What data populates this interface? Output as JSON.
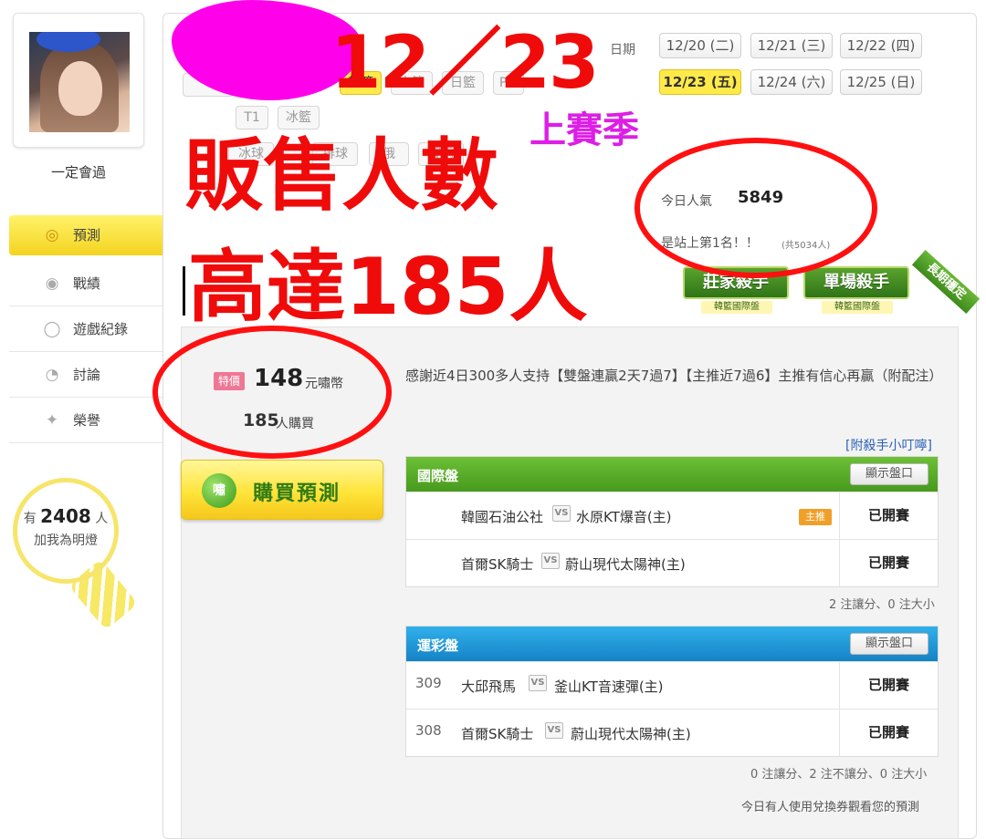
{
  "profile": {
    "username": "一定會過"
  },
  "nav": {
    "items": [
      {
        "label": "預測",
        "icon": "target-icon",
        "glyph": "◎",
        "active": true
      },
      {
        "label": "戰績",
        "icon": "record-icon",
        "glyph": "◉",
        "active": false
      },
      {
        "label": "遊戲紀錄",
        "icon": "history-icon",
        "glyph": "◯",
        "active": false
      },
      {
        "label": "討論",
        "icon": "discussion-icon",
        "glyph": "◔",
        "active": false
      },
      {
        "label": "榮譽",
        "icon": "honor-icon",
        "glyph": "✦",
        "active": false
      }
    ]
  },
  "fans": {
    "prefix": "有",
    "count": "2408",
    "suffix": "人",
    "line2": "加我為明燈"
  },
  "dates": {
    "label": "日期",
    "items": [
      {
        "label": "12/20 (二)",
        "active": false
      },
      {
        "label": "12/21 (三)",
        "active": false
      },
      {
        "label": "12/22 (四)",
        "active": false
      },
      {
        "label": "12/23 (五)",
        "active": true
      },
      {
        "label": "12/24 (六)",
        "active": false
      },
      {
        "label": "12/25 (日)",
        "active": false
      }
    ]
  },
  "sports": {
    "row1": [
      "韓籃",
      "中籃",
      "日籃",
      "P+"
    ],
    "row2": [
      "T1",
      "冰籃"
    ],
    "row3": [
      "冰球",
      "排球",
      "俄",
      "賽馬"
    ]
  },
  "popularity": {
    "label": "今日人氣",
    "value": "5849",
    "rank_text": "是站上第1名！！",
    "rank_note": "(共5034人)"
  },
  "badges": {
    "badge1": {
      "title": "莊家殺手",
      "sub": "韓籃國際盤"
    },
    "badge2": {
      "title": "單場殺手",
      "sub": "韓籃國際盤"
    },
    "ribbon": "長期穩定"
  },
  "price": {
    "tag": "特價",
    "amount": "148",
    "unit": "元嘯幣",
    "buyers": "185",
    "buyers_unit": "人購買"
  },
  "buy_button": {
    "icon_text": "嘯",
    "label": "購買預測"
  },
  "description": "感謝近4日300多人支持【雙盤連贏2天7過7】【主推近7過6】主推有信心再贏（附配注）",
  "tips_link": "[附殺手小叮嚀]",
  "international": {
    "title": "國際盤",
    "show_label": "顯示盤口",
    "rows": [
      {
        "no": "",
        "home": "韓國石油公社",
        "away": "水原KT爆音(主)",
        "tag": "主推",
        "status": "已開賽"
      },
      {
        "no": "",
        "home": "首爾SK騎士",
        "away": "蔚山現代太陽神(主)",
        "tag": "",
        "status": "已開賽"
      }
    ],
    "summary": "2 注讓分、0 注大小"
  },
  "lottery": {
    "title": "運彩盤",
    "show_label": "顯示盤口",
    "rows": [
      {
        "no": "309",
        "home": "大邱飛馬",
        "away": "釜山KT音速彈(主)",
        "tag": "",
        "status": "已開賽"
      },
      {
        "no": "308",
        "home": "首爾SK騎士",
        "away": "蔚山現代太陽神(主)",
        "tag": "",
        "status": "已開賽"
      }
    ],
    "summary": "0 注讓分、2 注不讓分、0 注大小"
  },
  "vs_text": "VS",
  "footer_note": "今日有人使用兌換券觀看您的預測",
  "annotations": {
    "date_big": "12／23",
    "line1": "販售人數",
    "line2": "高達185人",
    "season": "上賽季"
  },
  "colors": {
    "accent_yellow": "#ffe94c",
    "international_head": "#5aae2a",
    "lottery_head": "#1f9ad8",
    "annotation_red": "#f00b0b",
    "annotation_magenta": "#dd1ee6"
  }
}
